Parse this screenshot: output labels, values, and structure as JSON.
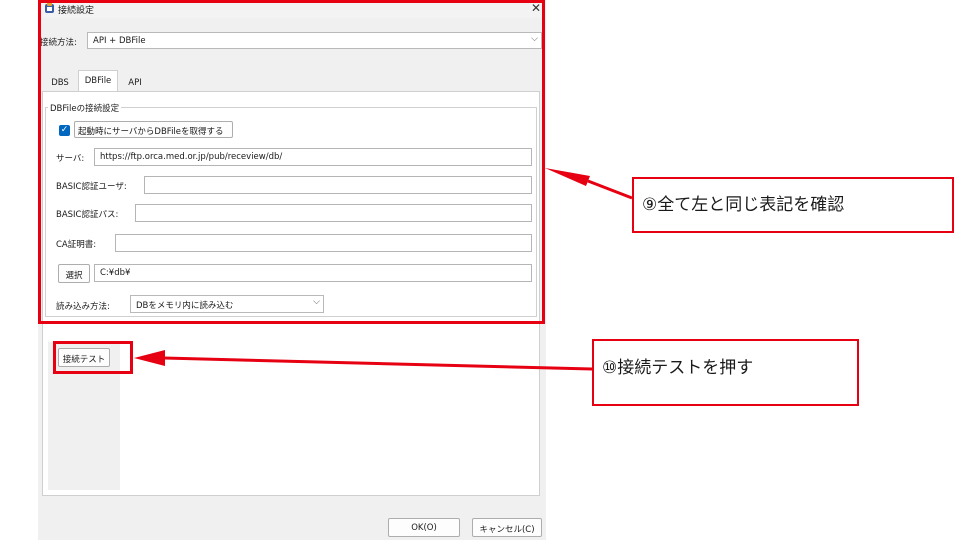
{
  "dialog": {
    "title": "接続設定",
    "connection_method": {
      "label": "接続方法:",
      "value": "API + DBFile"
    },
    "tabs": [
      {
        "label": "DBS",
        "active": false
      },
      {
        "label": "DBFile",
        "active": true
      },
      {
        "label": "API",
        "active": false
      }
    ],
    "group_title": "DBFileの接続設定",
    "fetch_on_start": {
      "label": "起動時にサーバからDBFileを取得する",
      "checked": true
    },
    "server": {
      "label": "サーバ:",
      "value": "https://ftp.orca.med.or.jp/pub/receview/db/"
    },
    "basic_user": {
      "label": "BASIC認証ユーザ:",
      "value": ""
    },
    "basic_pass": {
      "label": "BASIC認証パス:",
      "value": ""
    },
    "ca_cert": {
      "label": "CA証明書:",
      "value": ""
    },
    "select_button": "選択",
    "path_value": "C:¥db¥",
    "load_method": {
      "label": "読み込み方法:",
      "value": "DBをメモリ内に読み込む"
    },
    "test_button": "接続テスト",
    "ok_button": "OK(O)",
    "cancel_button": "キャンセル(C)"
  },
  "annotations": {
    "callout_9": "⑨全て左と同じ表記を確認",
    "callout_10": "⑩接続テストを押す",
    "accent_color": "#e60012"
  }
}
